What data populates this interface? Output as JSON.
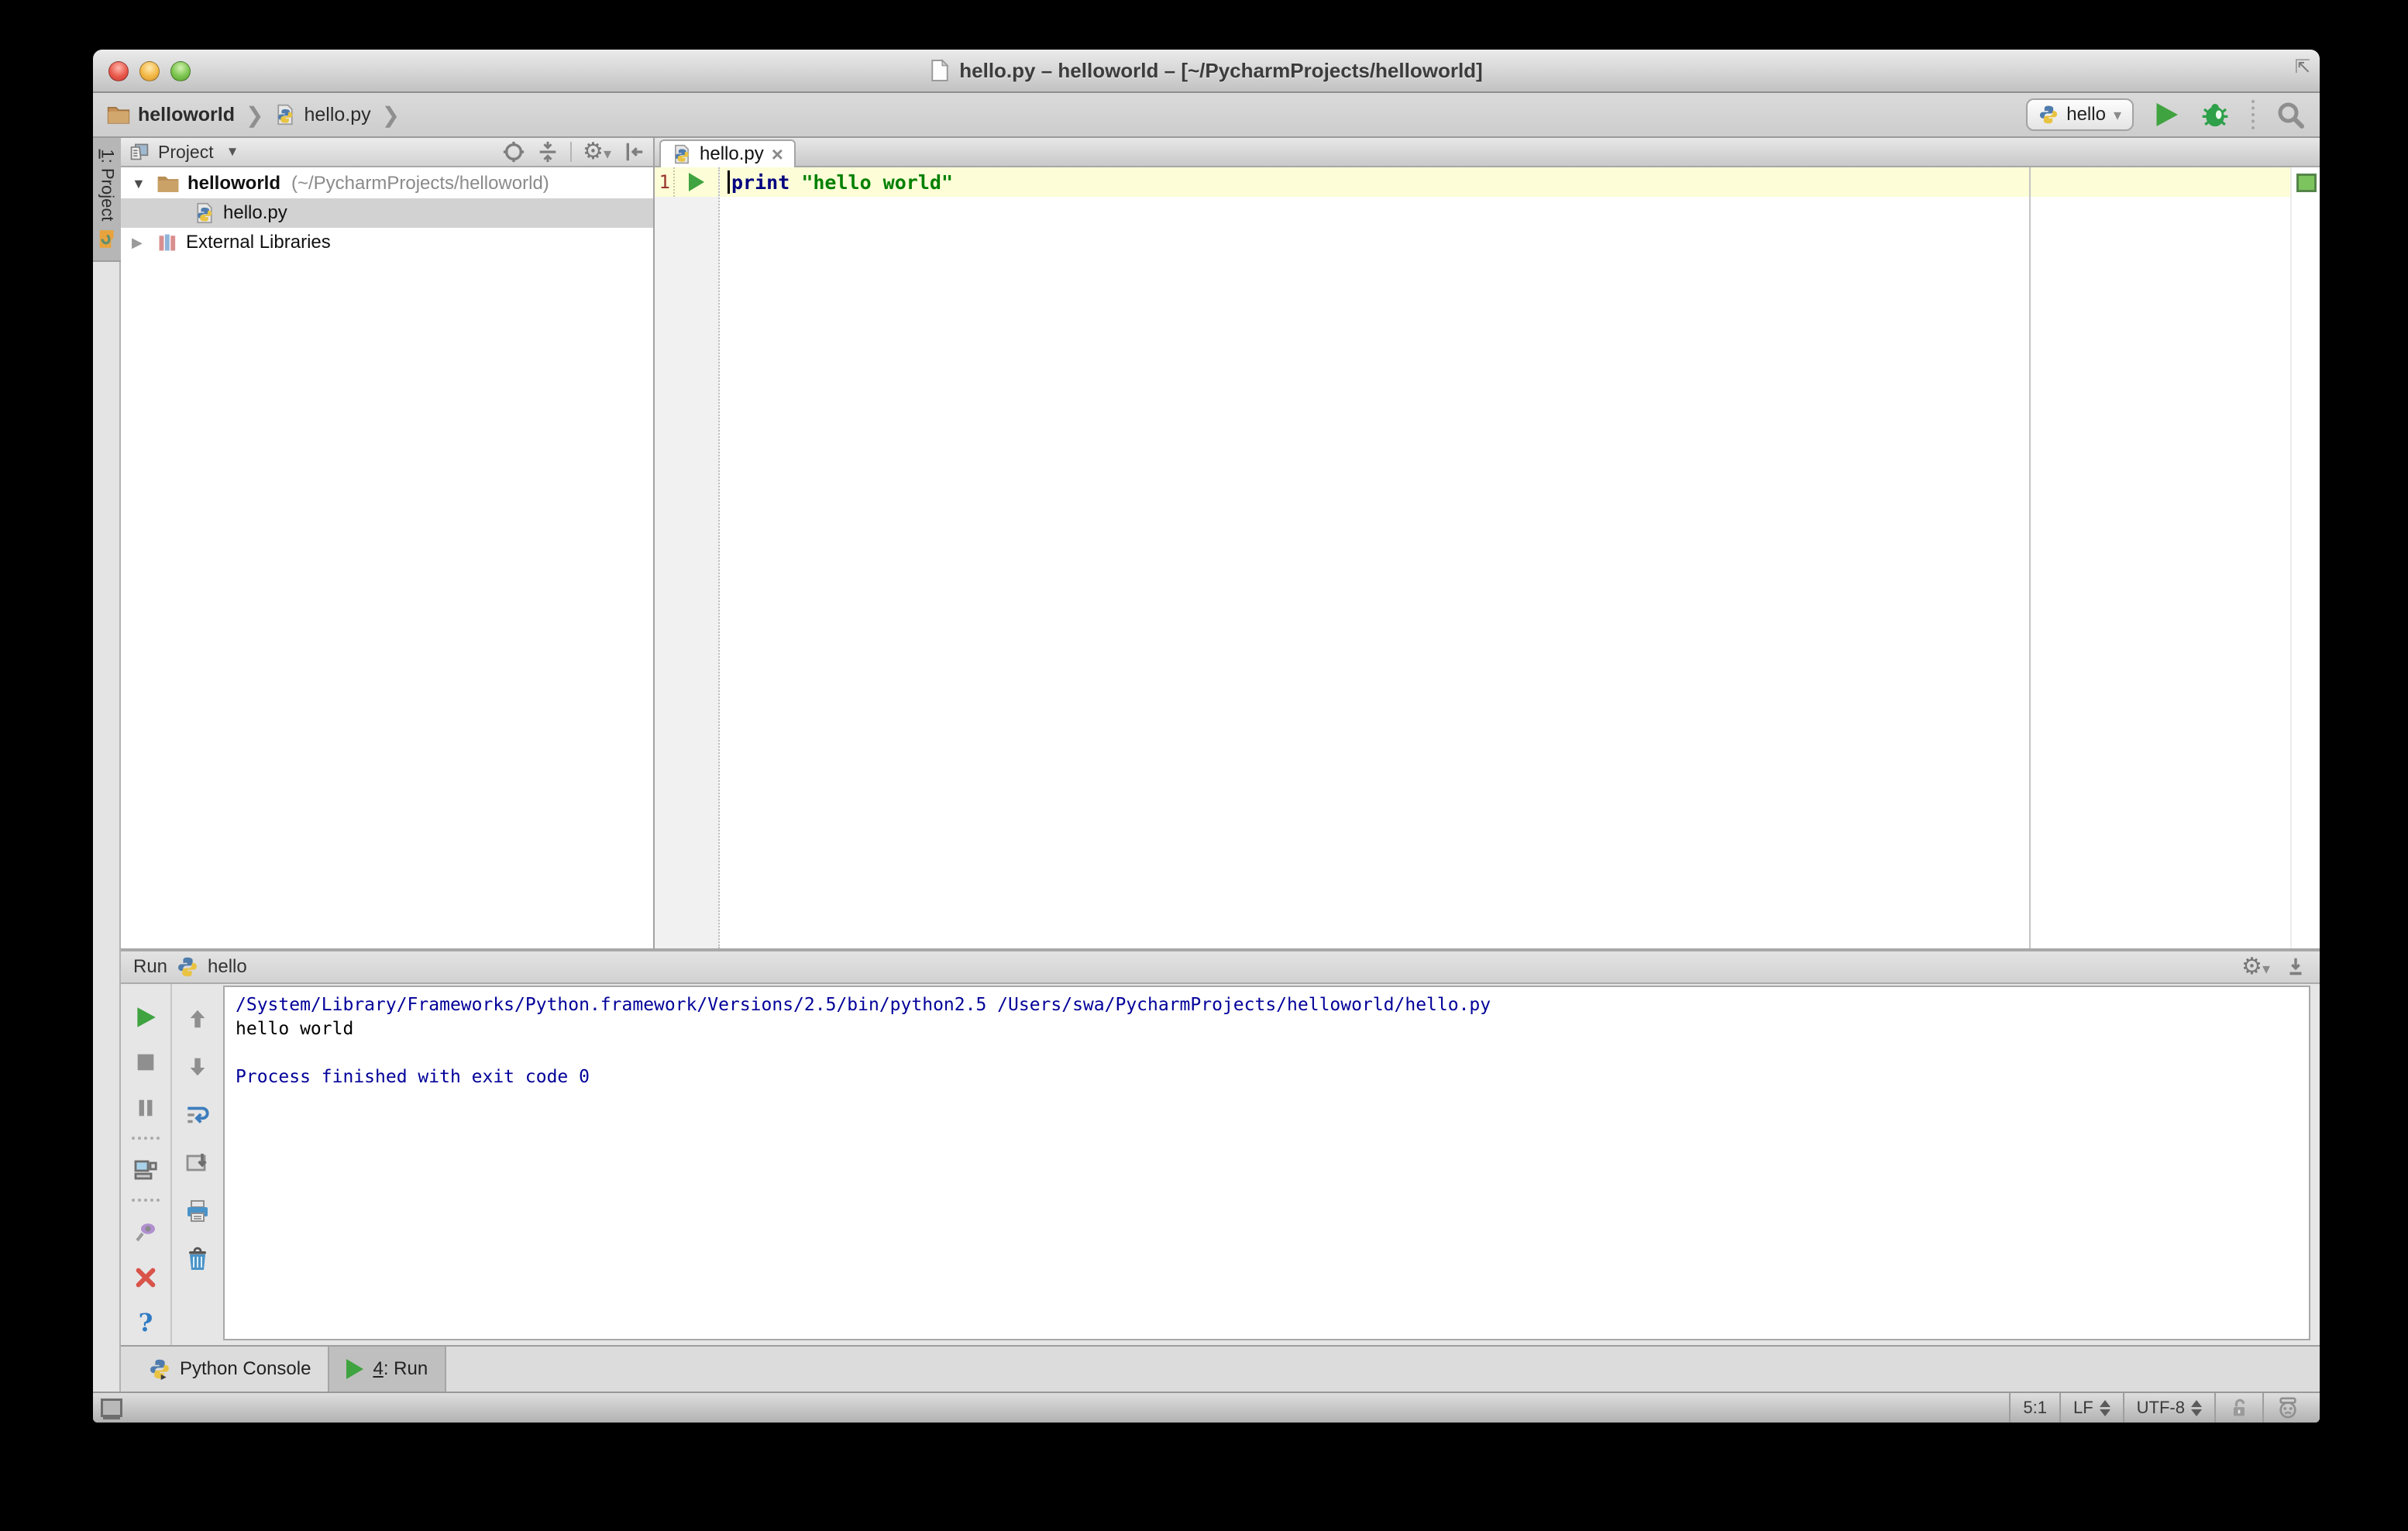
{
  "window": {
    "title": "hello.py – helloworld – [~/PycharmProjects/helloworld]"
  },
  "breadcrumb": {
    "project": "helloworld",
    "file": "hello.py"
  },
  "run_controls": {
    "config_name": "hello"
  },
  "left_stripe": {
    "tab_num": "1",
    "tab_rest": ": Project"
  },
  "project_panel": {
    "title": "Project",
    "root_name": "helloworld",
    "root_path": "(~/PycharmProjects/helloworld)",
    "file_name": "hello.py",
    "libs_label": "External Libraries"
  },
  "editor": {
    "tab_label": "hello.py",
    "line_number": "1",
    "code_keyword": "print",
    "code_string": "\"hello world\""
  },
  "run_panel": {
    "label": "Run",
    "tab_name": "hello",
    "console_line1": "/System/Library/Frameworks/Python.framework/Versions/2.5/bin/python2.5 /Users/swa/PycharmProjects/helloworld/hello.py",
    "console_line2": "hello world",
    "console_line3": "Process finished with exit code 0"
  },
  "bottom_tabs": {
    "console_tab": "Python Console",
    "run_tab_num": "4",
    "run_tab_rest": ": Run"
  },
  "status_bar": {
    "caret": "5:1",
    "line_sep": "LF",
    "encoding": "UTF-8"
  },
  "colors": {
    "keyword": "#000080",
    "string": "#008000",
    "console_info": "#000099",
    "run_green": "#3fa33f",
    "inspection_ok": "#7cc45e",
    "current_line": "#fdfdd7"
  }
}
